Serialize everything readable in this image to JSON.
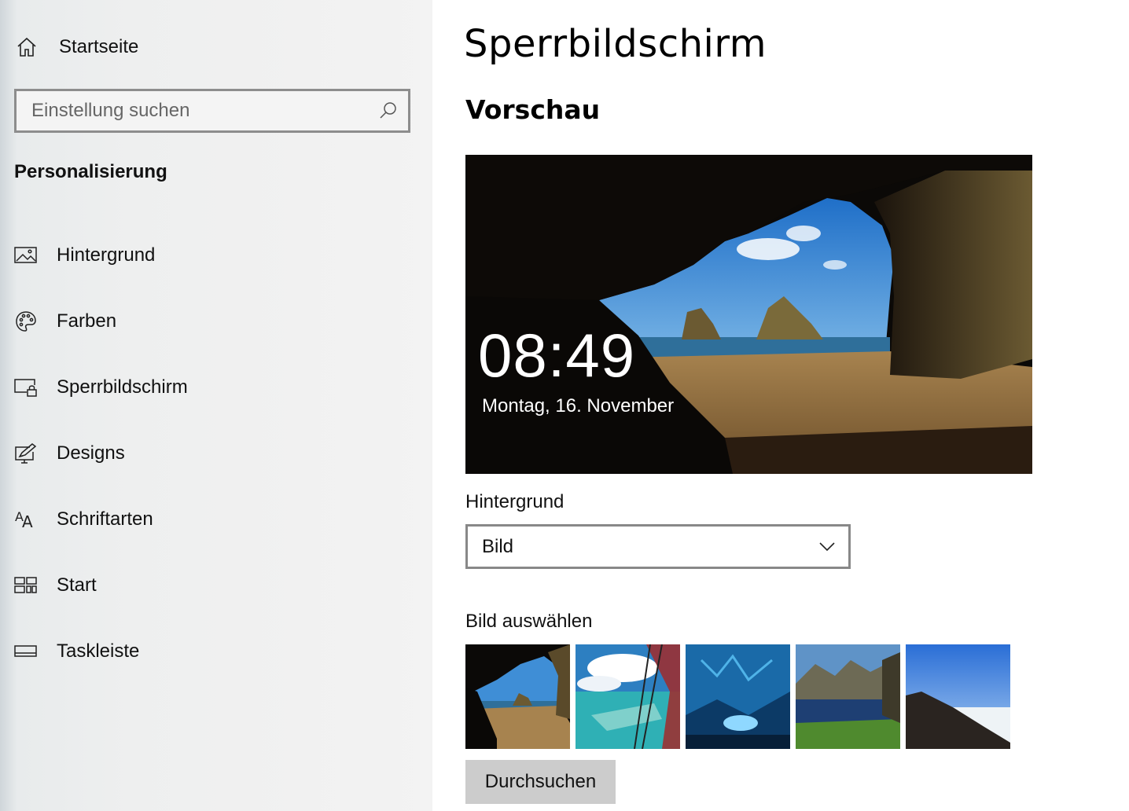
{
  "sidebar": {
    "home_label": "Startseite",
    "search_placeholder": "Einstellung suchen",
    "section_title": "Personalisierung",
    "items": [
      {
        "label": "Hintergrund",
        "icon": "image-icon"
      },
      {
        "label": "Farben",
        "icon": "palette-icon"
      },
      {
        "label": "Sperrbildschirm",
        "icon": "lockscreen-icon"
      },
      {
        "label": "Designs",
        "icon": "designs-icon"
      },
      {
        "label": "Schriftarten",
        "icon": "fonts-icon"
      },
      {
        "label": "Start",
        "icon": "start-icon"
      },
      {
        "label": "Taskleiste",
        "icon": "taskbar-icon"
      }
    ]
  },
  "main": {
    "title": "Sperrbildschirm",
    "preview_title": "Vorschau",
    "preview": {
      "time": "08:49",
      "date": "Montag, 16. November"
    },
    "background_label": "Hintergrund",
    "background_value": "Bild",
    "pick_label": "Bild auswählen",
    "browse_label": "Durchsuchen"
  }
}
